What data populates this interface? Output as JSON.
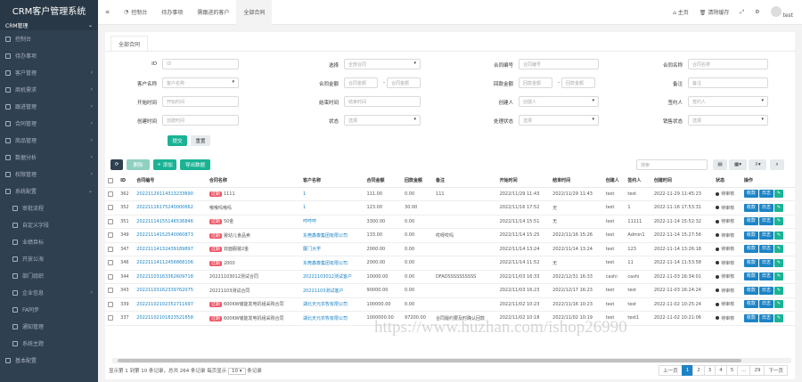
{
  "app": {
    "title": "CRM客户管理系统",
    "sub": "CRM管理"
  },
  "sidebar": {
    "items": [
      {
        "label": "控制台",
        "child": false,
        "chev": ""
      },
      {
        "label": "待办事项",
        "child": false,
        "chev": ""
      },
      {
        "label": "客户管理",
        "child": false,
        "chev": "‹"
      },
      {
        "label": "商机需求",
        "child": false,
        "chev": "‹"
      },
      {
        "label": "跟进管理",
        "child": false,
        "chev": "‹"
      },
      {
        "label": "合同管理",
        "child": false,
        "chev": "‹"
      },
      {
        "label": "商品管理",
        "child": false,
        "chev": "‹"
      },
      {
        "label": "数据分析",
        "child": false,
        "chev": "‹"
      },
      {
        "label": "权限管理",
        "child": false,
        "chev": "‹"
      },
      {
        "label": "系统配置",
        "child": false,
        "chev": "⌄"
      },
      {
        "label": "审批流程",
        "child": true,
        "chev": ""
      },
      {
        "label": "自定义字段",
        "child": true,
        "chev": ""
      },
      {
        "label": "业绩目标",
        "child": true,
        "chev": ""
      },
      {
        "label": "开放公海",
        "child": true,
        "chev": ""
      },
      {
        "label": "部门组织",
        "child": true,
        "chev": ""
      },
      {
        "label": "企业信息",
        "child": true,
        "chev": "‹"
      },
      {
        "label": "FA同步",
        "child": true,
        "chev": ""
      },
      {
        "label": "通知管理",
        "child": true,
        "chev": ""
      },
      {
        "label": "系统主题",
        "child": true,
        "chev": ""
      },
      {
        "label": "基本配置",
        "child": false,
        "chev": ""
      }
    ]
  },
  "topbar": {
    "menu_icon": "≡",
    "tabs": [
      "控制台",
      "待办事项",
      "需跟进的客户",
      "全部合同"
    ],
    "active": 3,
    "right": {
      "home": "主页",
      "clear": "清除缓存",
      "user": "test"
    }
  },
  "content_tab": "全部合同",
  "filters": {
    "row1": [
      {
        "label": "ID",
        "ph": "ID"
      },
      {
        "label": "选择",
        "ph": "全部合同",
        "sel": true
      },
      {
        "label": "合同编号",
        "ph": "合同编号"
      },
      {
        "label": "合同名称",
        "ph": "合同名称"
      }
    ],
    "row2": [
      {
        "label": "客户名称",
        "ph": "客户名称",
        "sel": true
      },
      {
        "label": "合同金额",
        "ph": "合同金额",
        "ph2": "合同金额"
      },
      {
        "label": "回款金额",
        "ph": "回款金额",
        "ph2": "回款金额"
      },
      {
        "label": "备注",
        "ph": "备注"
      }
    ],
    "row3": [
      {
        "label": "开始时间",
        "ph": "开始时间"
      },
      {
        "label": "结束时间",
        "ph": "结束时间"
      },
      {
        "label": "创建人",
        "ph": "创建人",
        "sel": true
      },
      {
        "label": "签约人",
        "ph": "签约人",
        "sel": true
      }
    ],
    "row4": [
      {
        "label": "创建时间",
        "ph": "创建时间"
      },
      {
        "label": "状态",
        "ph": "选择",
        "sel": true
      },
      {
        "label": "处理状态",
        "ph": "选择",
        "sel": true
      },
      {
        "label": "销售状态",
        "ph": "选择",
        "sel": true
      }
    ],
    "submit": "提交",
    "reset": "重置"
  },
  "toolbar": {
    "refresh": "⟳",
    "delete": "删除",
    "add": "添加",
    "export": "导出数据",
    "search_ph": "搜索"
  },
  "table": {
    "headers": [
      "ID",
      "合同编号",
      "合同名称",
      "客户名称",
      "合同金额",
      "回款金额",
      "备注",
      "开始时间",
      "结束时间",
      "创建人",
      "签约人",
      "创建时间",
      "状态",
      "操作"
    ],
    "rows": [
      {
        "id": "362",
        "no": "20221129114313233690",
        "tag": "过期",
        "name": "1111",
        "cust": "1",
        "amt": "111.00",
        "back": "0.00",
        "note": "111",
        "start": "2022/11/29 11:43",
        "end": "2022/11/29 11:43",
        "creator": "test",
        "signer": "test",
        "ctime": "2022-11-29 11:45:23",
        "status": "待审核"
      },
      {
        "id": "352",
        "no": "20221116175240000662",
        "tag": "",
        "name": "哦哦吗哦吗",
        "cust": "1",
        "amt": "123.00",
        "back": "30.00",
        "note": "",
        "start": "2022/11/16 17:52",
        "end": "无",
        "creator": "test",
        "signer": "1",
        "ctime": "2022-11-16 17:53:31",
        "status": "待审核"
      },
      {
        "id": "351",
        "no": "20221114155146536846",
        "tag": "过期",
        "name": "50金",
        "cust": "哼哼哼",
        "amt": "3300.00",
        "back": "0.00",
        "note": "",
        "start": "2022/11/14 15:51",
        "end": "无",
        "creator": "test",
        "signer": "11111",
        "ctime": "2022-11-14 15:52:32",
        "status": "待审核"
      },
      {
        "id": "349",
        "no": "20221114152540060873",
        "tag": "过期",
        "name": "婴幼儿食品卖",
        "cust": "东莞鑫泰集团有限公司",
        "amt": "133.00",
        "back": "0.00",
        "note": "哎呀哎吗",
        "start": "2022/11/14 15:25",
        "end": "2022/11/16 15:26",
        "creator": "test",
        "signer": "Admin1",
        "ctime": "2022-11-14 15:27:56",
        "status": "待审核"
      },
      {
        "id": "347",
        "no": "20221114132439189897",
        "tag": "过期",
        "name": "双面服装2金",
        "cust": "厦门大学",
        "amt": "2000.00",
        "back": "0.00",
        "note": "",
        "start": "2022/11/14 13:24",
        "end": "2022/11/14 13:24",
        "creator": "test",
        "signer": "123",
        "ctime": "2022-11-14 13:26:18",
        "status": "待审核"
      },
      {
        "id": "346",
        "no": "20221114112456868106",
        "tag": "过期",
        "name": "2000",
        "cust": "东莞鑫泰集团有限公司",
        "amt": "2000.00",
        "back": "0.00",
        "note": "",
        "start": "2022/11/14 11:52",
        "end": "无",
        "creator": "test",
        "signer": "11",
        "ctime": "2022-11-14 11:53:58",
        "status": "待审核"
      },
      {
        "id": "344",
        "no": "20221103163362609718",
        "tag": "",
        "name": "20221103012测试合同",
        "cust": "20221103012测试客户",
        "amt": "10000.00",
        "back": "0.00",
        "note": "DFADSSSSSSSSSS",
        "start": "2022/11/03 16:33",
        "end": "2022/12/31 16:33",
        "creator": "cashi",
        "signer": "cashi",
        "ctime": "2022-11-03 16:34:01",
        "status": "待审核"
      },
      {
        "id": "343",
        "no": "20221103162339762075",
        "tag": "",
        "name": "20221103测试合同",
        "cust": "20221103测试客户",
        "amt": "90000.00",
        "back": "0.00",
        "note": "",
        "start": "2022/11/03 16:23",
        "end": "2022/12/17 16:23",
        "creator": "test",
        "signer": "test",
        "ctime": "2022-11-03 16:24:24",
        "status": "待审核"
      },
      {
        "id": "339",
        "no": "20221102102352711697",
        "tag": "过期",
        "name": "600KW储能发电机组采购合同",
        "cust": "湖北天元农牧有限公司",
        "amt": "100000.00",
        "back": "0.00",
        "note": "",
        "start": "2022/11/02 10:23",
        "end": "2022/11/16 10:23",
        "creator": "test",
        "signer": "test",
        "ctime": "2022-11-02 10:25:24",
        "status": "待审核"
      },
      {
        "id": "337",
        "no": "20221102101823521658",
        "tag": "过期",
        "name": "600KW储能发电机组采购合同",
        "cust": "湖北天元农牧有限公司",
        "amt": "1000000.00",
        "back": "97200.00",
        "note": "合同履约要及时确认回款",
        "start": "2022/11/02 10:18",
        "end": "2022/11/02 10:19",
        "creator": "test",
        "signer": "test1",
        "ctime": "2022-11-02 10:21:06",
        "status": "待审核"
      }
    ],
    "ops": {
      "a": "收款",
      "b": "日志",
      "c": "✎"
    }
  },
  "footer": {
    "text": "显示第 1 到第 10 条记录，总共 264 条记录 每页显示",
    "per": "10",
    "suffix": "条记录"
  },
  "pager": [
    "上一页",
    "1",
    "2",
    "3",
    "4",
    "5",
    "...",
    "29",
    "下一页"
  ],
  "watermark": "https://www.huzhan.com/ishop26990",
  "colors": {
    "sidebar": "#2f4050",
    "teal": "#1ab394",
    "blue": "#1c84c6",
    "red": "#ed5565"
  }
}
